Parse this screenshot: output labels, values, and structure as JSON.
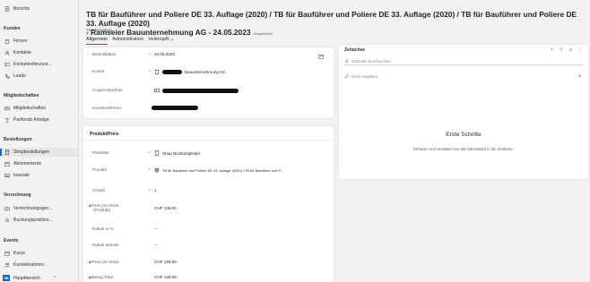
{
  "sidebar": {
    "top_item": "Berichte",
    "groups": [
      {
        "label": "Kunden"
      },
      {
        "label": "Mitgliedschaften"
      },
      {
        "label": "Bestellungen"
      },
      {
        "label": "Verrechnung"
      },
      {
        "label": "Events"
      }
    ],
    "items": {
      "firmen": "Firmen",
      "kontakte": "Kontakte",
      "kontaktrollen": "Kontaktrollenzuor...",
      "leads": "Leads",
      "mitgliedschaften": "Mitgliedschaften",
      "anfragen": "Parifonds Anträge",
      "shopbestellungen": "Shopbestellungen",
      "abonnemente": "Abonnemente",
      "inserate": "Inserate",
      "verrechnungen": "Verrechnungsgen...",
      "buchungspositionen": "Buchungsposition...",
      "kurse": "Kurse",
      "kursteilnahmen": "Kursteilnahmen"
    },
    "area": {
      "badge": "HB",
      "label": "Hauptbereich",
      "chevron": "⌃"
    }
  },
  "header": {
    "title": "TB für Bauführer und Poliere DE 33. Auflage (2020) / TB für Bauführer und Poliere DE 33. Auflage (2020) / TB für Bauführer und Poliere DE 33. Auflage (2020)",
    "title2": "- Ramseier Bauunternehmung AG - 24.05.2023",
    "saved": "Gespeichert",
    "entity": "Shopbestellung"
  },
  "tabs": [
    "Allgemein",
    "Administration",
    "Verknüpft ⌄"
  ],
  "general": {
    "bestelldatum": {
      "label": "Bestelldatum",
      "req": "*",
      "value": "24.05.2023"
    },
    "kunde": {
      "label": "Kunde",
      "req": "*",
      "value": "Bauunternehmung AG"
    },
    "ansprechpartner": {
      "label": "Ansprechpartner"
    },
    "kundenreferenz": {
      "label": "Kundenreferenz"
    }
  },
  "produkt": {
    "section_title": "Produkt/Preis",
    "preisliste": {
      "label": "Preisliste",
      "req": "*",
      "value": "Shop Nichtmitglieder"
    },
    "produkt": {
      "label": "Produkt",
      "req": "*",
      "value": "TB für Bauführer und Poliere DE 33. Auflage (2020) / TB für Bauführer und P..."
    },
    "anzahl": {
      "label": "Anzahl",
      "req": "*",
      "value": "1"
    },
    "preis_stueck_produkt": {
      "label_l1": "Preis pro Stück",
      "label_l2": "(Produkt)",
      "value": "CHF 139.00"
    },
    "rabatt_prozent": {
      "label": "Rabatt in %",
      "value": "---"
    },
    "rabatt_absolut": {
      "label": "Rabatt absolut",
      "value": "---"
    },
    "preis_stueck": {
      "label": "Preis pro Stück",
      "value": "CHF 139.00"
    },
    "betrag_total": {
      "label": "Betrag Total",
      "value": "CHF 139.00"
    }
  },
  "timeline": {
    "title": "Zeitachse",
    "tools": [
      "+",
      "▽",
      "≡",
      "⋮"
    ],
    "search_placeholder": "Zeitleiste durchsuchen",
    "note_placeholder": "Notiz eingeben...",
    "empty_title": "Erste Schritte",
    "empty_sub": "Erfassen und verwalten Sie alle Datensätze in der Zeitleiste."
  },
  "colors": {
    "accent": "#0f6cbd",
    "required": "#a4262c"
  }
}
